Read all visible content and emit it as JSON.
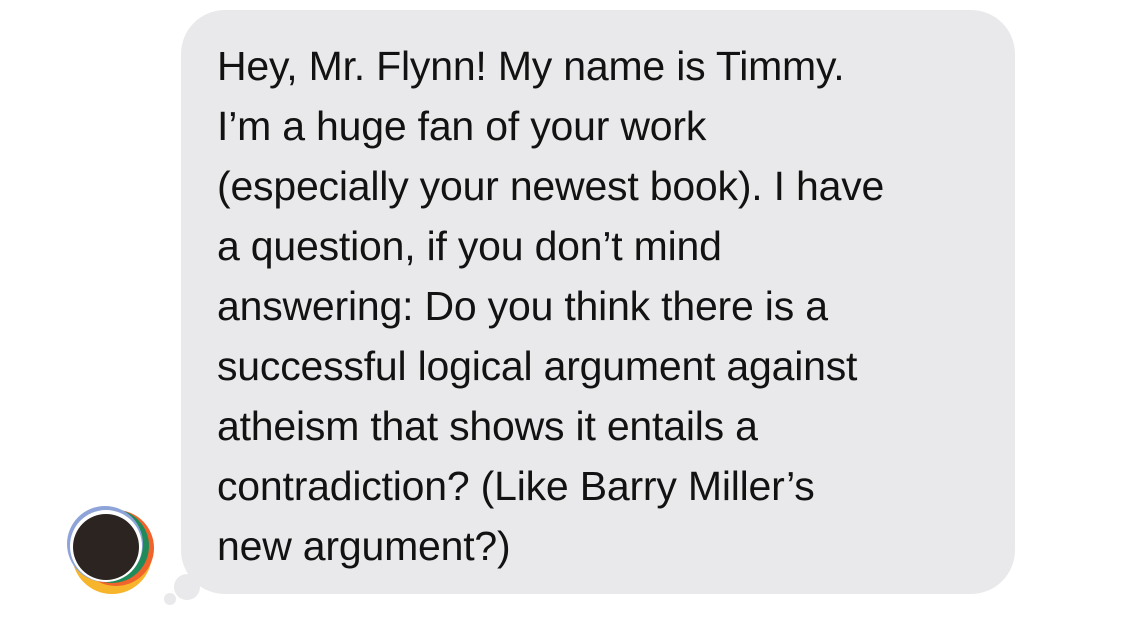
{
  "message": {
    "sender_avatar_icon": "contact-avatar-icon",
    "text": "Hey, Mr. Flynn! My name is Timmy.\nI’m a huge fan of your work\n(especially your newest book). I have\na question, if you don’t mind\nanswering: Do you think there is a\nsuccessful logical argument against\natheism that shows it entails a\ncontradiction? (Like Barry Miller’s\nnew argument?)"
  },
  "colors": {
    "bubble": "#e9e9eb",
    "text": "#121212",
    "avatar_core": "#2b2420",
    "avatar_ring_orange": "#f0632b",
    "avatar_ring_yellow": "#f7b52b",
    "avatar_ring_green": "#1f8a5a",
    "avatar_ring_blue": "#8ea4d8"
  }
}
